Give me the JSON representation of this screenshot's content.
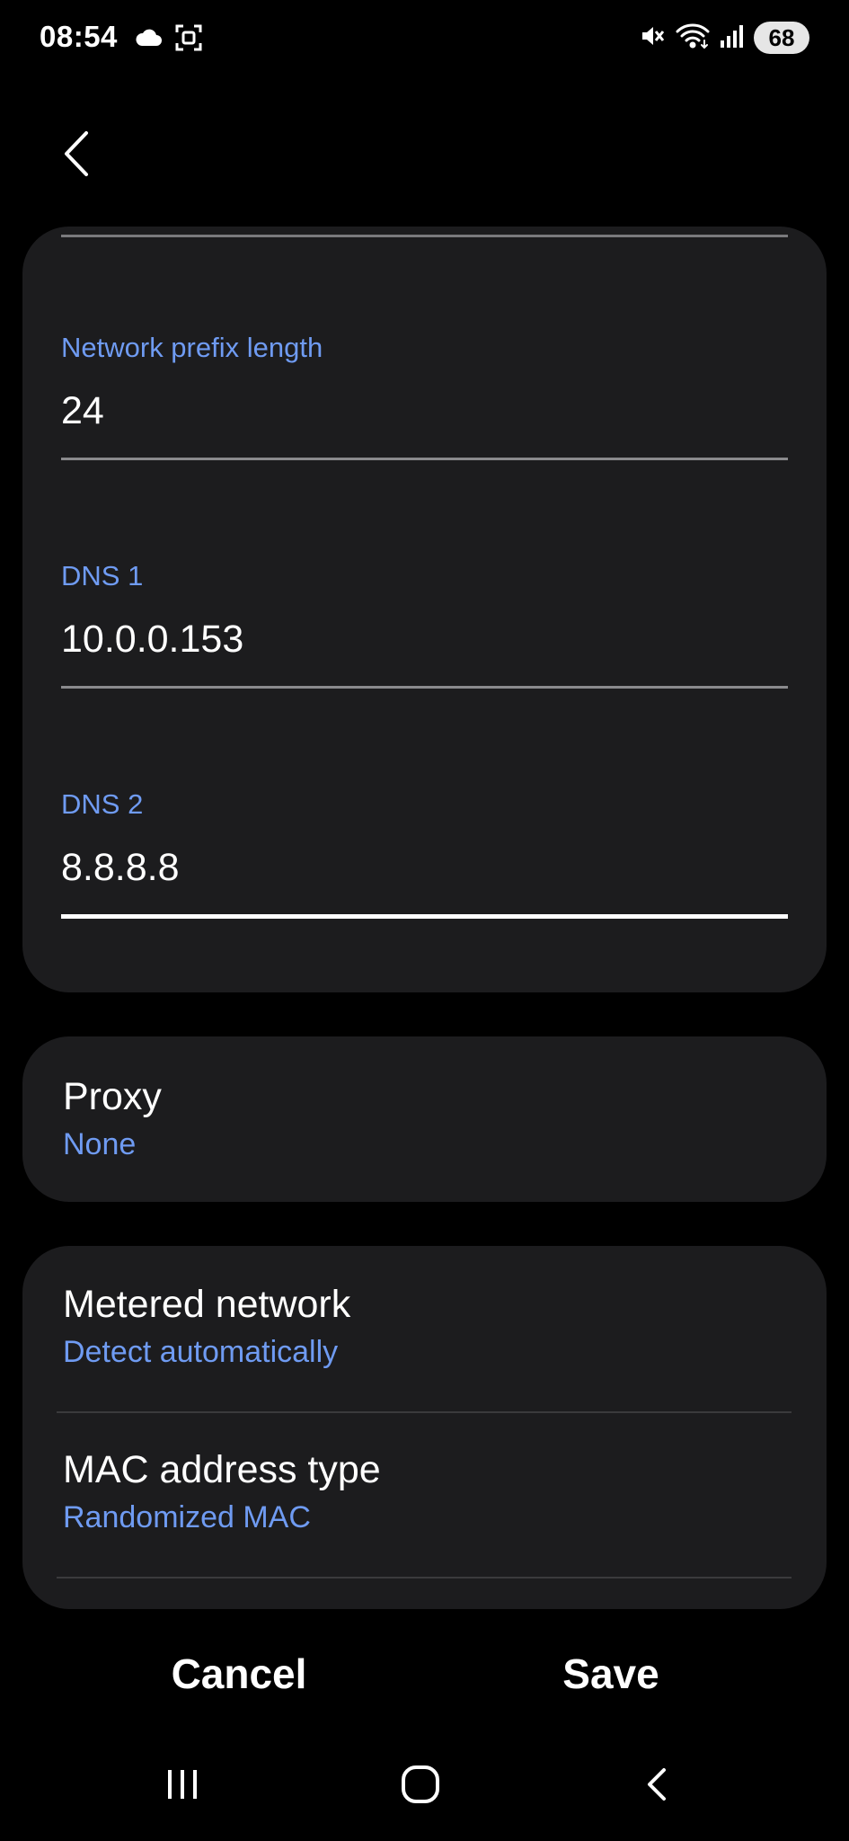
{
  "status_bar": {
    "time": "08:54",
    "battery": "68",
    "icons": [
      "cloud-icon",
      "screenshot-icon",
      "mute-icon",
      "wifi-icon",
      "signal-icon"
    ]
  },
  "navigation": {
    "back_icon": "chevron-left-icon"
  },
  "ip_settings": {
    "prefix": {
      "label": "Network prefix length",
      "value": "24"
    },
    "dns1": {
      "label": "DNS 1",
      "value": "10.0.0.153"
    },
    "dns2": {
      "label": "DNS 2",
      "value": "8.8.8.8"
    }
  },
  "proxy": {
    "title": "Proxy",
    "value": "None"
  },
  "advanced": {
    "metered": {
      "title": "Metered network",
      "value": "Detect automatically"
    },
    "mac": {
      "title": "MAC address type",
      "value": "Randomized MAC"
    }
  },
  "actions": {
    "cancel_label": "Cancel",
    "save_label": "Save"
  },
  "nav_bar": {
    "icons": [
      "recent-apps-icon",
      "home-icon",
      "back-icon"
    ]
  },
  "colors": {
    "background": "#000000",
    "card": "#1c1c1e",
    "accent": "#6f9bf2",
    "text": "#ffffff"
  }
}
